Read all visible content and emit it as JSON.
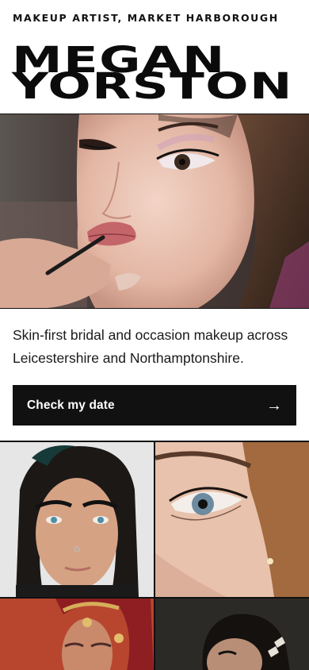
{
  "header": {
    "eyebrow": "MAKEUP ARTIST, MARKET HARBOROUGH",
    "name_line1": "MEGAN",
    "name_line2": "YORSTON"
  },
  "hero": {
    "image_alt": "Makeup artist applying lipstick to a client"
  },
  "intro": {
    "text": "Skin-first bridal and occasion makeup across Leicestershire and Northamptonshire."
  },
  "cta": {
    "label": "Check my date",
    "arrow": "→"
  },
  "gallery": {
    "items": [
      {
        "alt": "Freckled model with dark hair and winged brows"
      },
      {
        "alt": "Close-up of soft blue-eyed glam"
      },
      {
        "alt": "Bridal look with red dupatta and jewellery"
      },
      {
        "alt": "Editorial look with hair clips"
      }
    ]
  },
  "colors": {
    "ink": "#111111",
    "background": "#ffffff",
    "button": "#111111"
  }
}
